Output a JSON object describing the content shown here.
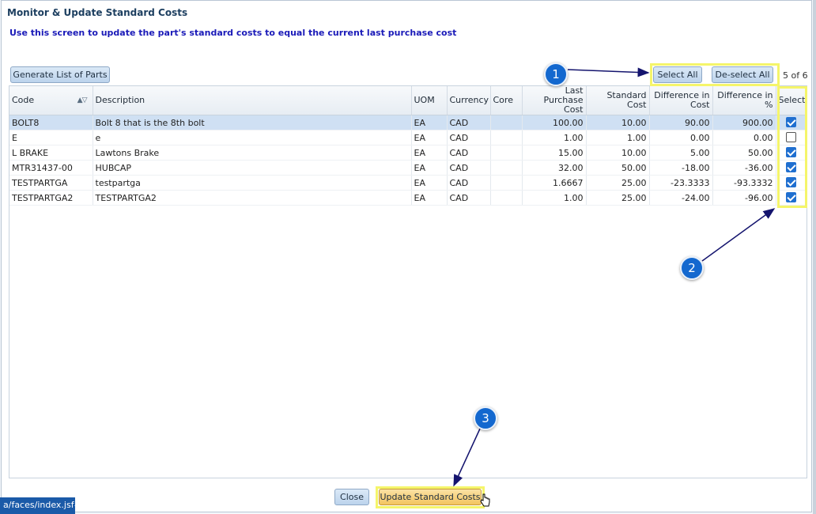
{
  "dialog": {
    "title": "Monitor & Update Standard Costs",
    "instructions": "Use this screen to update the part's standard costs to equal the current last purchase cost"
  },
  "toolbar": {
    "generate_label": "Generate List of Parts",
    "select_all_label": "Select All",
    "deselect_all_label": "De-select All",
    "count": "5 of 6"
  },
  "table": {
    "headers": {
      "code": "Code",
      "description": "Description",
      "uom": "UOM",
      "currency": "Currency",
      "core": "Core",
      "last_purchase_cost": "Last Purchase Cost",
      "standard_cost": "Standard Cost",
      "difference_cost": "Difference in Cost",
      "difference_pct": "Difference in %",
      "select": "Select"
    },
    "rows": [
      {
        "code": "BOLT8",
        "description": "Bolt 8 that is the 8th bolt",
        "uom": "EA",
        "currency": "CAD",
        "core": "",
        "last_purchase_cost": "100.00",
        "standard_cost": "10.00",
        "difference_cost": "90.00",
        "difference_pct": "900.00",
        "selected": true
      },
      {
        "code": "E",
        "description": "e",
        "uom": "EA",
        "currency": "CAD",
        "core": "",
        "last_purchase_cost": "1.00",
        "standard_cost": "1.00",
        "difference_cost": "0.00",
        "difference_pct": "0.00",
        "selected": false
      },
      {
        "code": "L BRAKE",
        "description": "Lawtons Brake",
        "uom": "EA",
        "currency": "CAD",
        "core": "",
        "last_purchase_cost": "15.00",
        "standard_cost": "10.00",
        "difference_cost": "5.00",
        "difference_pct": "50.00",
        "selected": true
      },
      {
        "code": "MTR31437-00",
        "description": "HUBCAP",
        "uom": "EA",
        "currency": "CAD",
        "core": "",
        "last_purchase_cost": "32.00",
        "standard_cost": "50.00",
        "difference_cost": "-18.00",
        "difference_pct": "-36.00",
        "selected": true
      },
      {
        "code": "TESTPARTGA",
        "description": "testpartga",
        "uom": "EA",
        "currency": "CAD",
        "core": "",
        "last_purchase_cost": "1.6667",
        "standard_cost": "25.00",
        "difference_cost": "-23.3333",
        "difference_pct": "-93.3332",
        "selected": true
      },
      {
        "code": "TESTPARTGA2",
        "description": "TESTPARTGA2",
        "uom": "EA",
        "currency": "CAD",
        "core": "",
        "last_purchase_cost": "1.00",
        "standard_cost": "25.00",
        "difference_cost": "-24.00",
        "difference_pct": "-96.00",
        "selected": true
      }
    ]
  },
  "footer": {
    "close_label": "Close",
    "update_label": "Update Standard Costs"
  },
  "annotations": {
    "badge_1": "1",
    "badge_2": "2",
    "badge_3": "3",
    "highlight_color": "#f5f56a",
    "badge_color": "#1368cf"
  },
  "status_bar": {
    "url": "a/faces/index.jsf#"
  },
  "icons": {
    "sort": "sort-asc-desc-icon",
    "cursor": "hand-pointer-icon",
    "checkbox_checked": "checkbox-checked-icon",
    "checkbox_unchecked": "checkbox-unchecked-icon"
  }
}
